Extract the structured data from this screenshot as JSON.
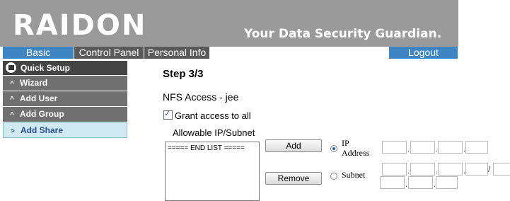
{
  "header": {
    "logo": "RAIDON",
    "tagline": "Your Data Security Guardian."
  },
  "tabs": {
    "basic": "Basic",
    "control_panel": "Control Panel",
    "personal_info": "Personal Info",
    "logout": "Logout"
  },
  "sidebar": {
    "quick_setup": "Quick Setup",
    "items": [
      {
        "label": "Wizard",
        "chev": "^"
      },
      {
        "label": "Add User",
        "chev": "^"
      },
      {
        "label": "Add Group",
        "chev": "^"
      },
      {
        "label": "Add Share",
        "chev": ">"
      }
    ]
  },
  "main": {
    "step": "Step 3/3",
    "nfs_title": "NFS Access - jee",
    "grant_label": "Grant access to all",
    "allowable_label": "Allowable IP/Subnet",
    "list": [
      "===== END LIST ====="
    ],
    "add_button": "Add",
    "remove_button": "Remove",
    "ip_label_1": "IP",
    "ip_label_2": "Address",
    "subnet_label": "Subnet",
    "subnet_separator": "/"
  },
  "colors": {
    "header_bg": "#9a9a9a",
    "tab_active": "#3e86c3",
    "tab_inactive": "#5a5a5a",
    "sidebar_bg": "#707070",
    "sidebar_active_bg": "#cfeaf0"
  }
}
